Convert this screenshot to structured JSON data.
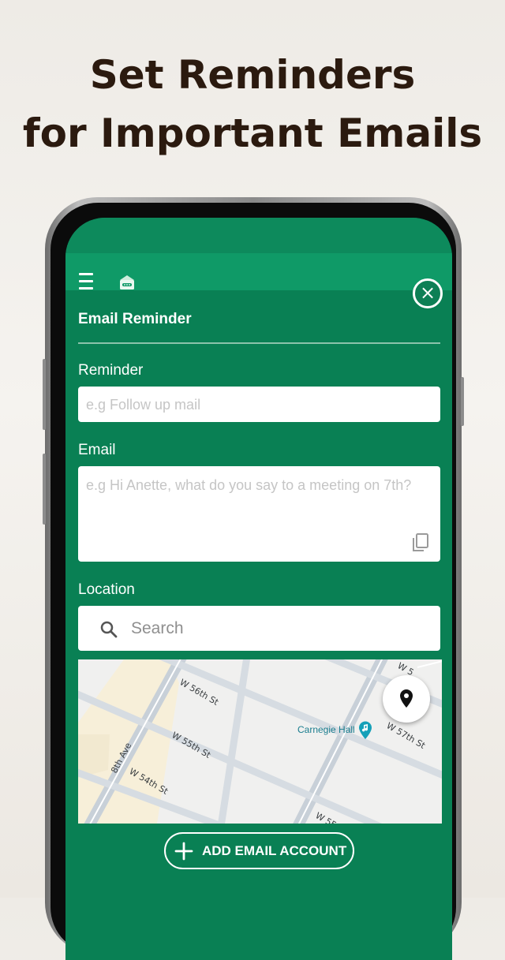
{
  "headline": {
    "line1": "Set Reminders",
    "line2": "for Important Emails"
  },
  "app": {
    "title": "Email Reminder",
    "reminder": {
      "label": "Reminder",
      "placeholder": "e.g Follow up mail"
    },
    "email": {
      "label": "Email",
      "placeholder": "e.g Hi Anette, what do you say to a meeting on 7th?"
    },
    "location": {
      "label": "Location",
      "search_placeholder": "Search"
    },
    "map": {
      "streets": [
        "W 56th St",
        "W 55th St",
        "W 54th St",
        "8th Ave",
        "W 57th St",
        "W 5",
        "W 55"
      ],
      "poi": "Carnegie Hall"
    },
    "add_account_label": "ADD EMAIL ACCOUNT"
  },
  "colors": {
    "primary_green": "#098054",
    "appbar_green": "#0f9a67",
    "headline": "#2b1a0f",
    "map_road": "#c8d0d8",
    "map_block": "#f7efd9"
  },
  "icons": {
    "menu": "hamburger-menu-icon",
    "logo": "email-app-logo-icon",
    "close": "close-circle-icon",
    "copy": "copy-icon",
    "search": "search-icon",
    "locate": "map-pin-icon",
    "poi": "music-venue-pin-icon",
    "add": "plus-icon"
  }
}
